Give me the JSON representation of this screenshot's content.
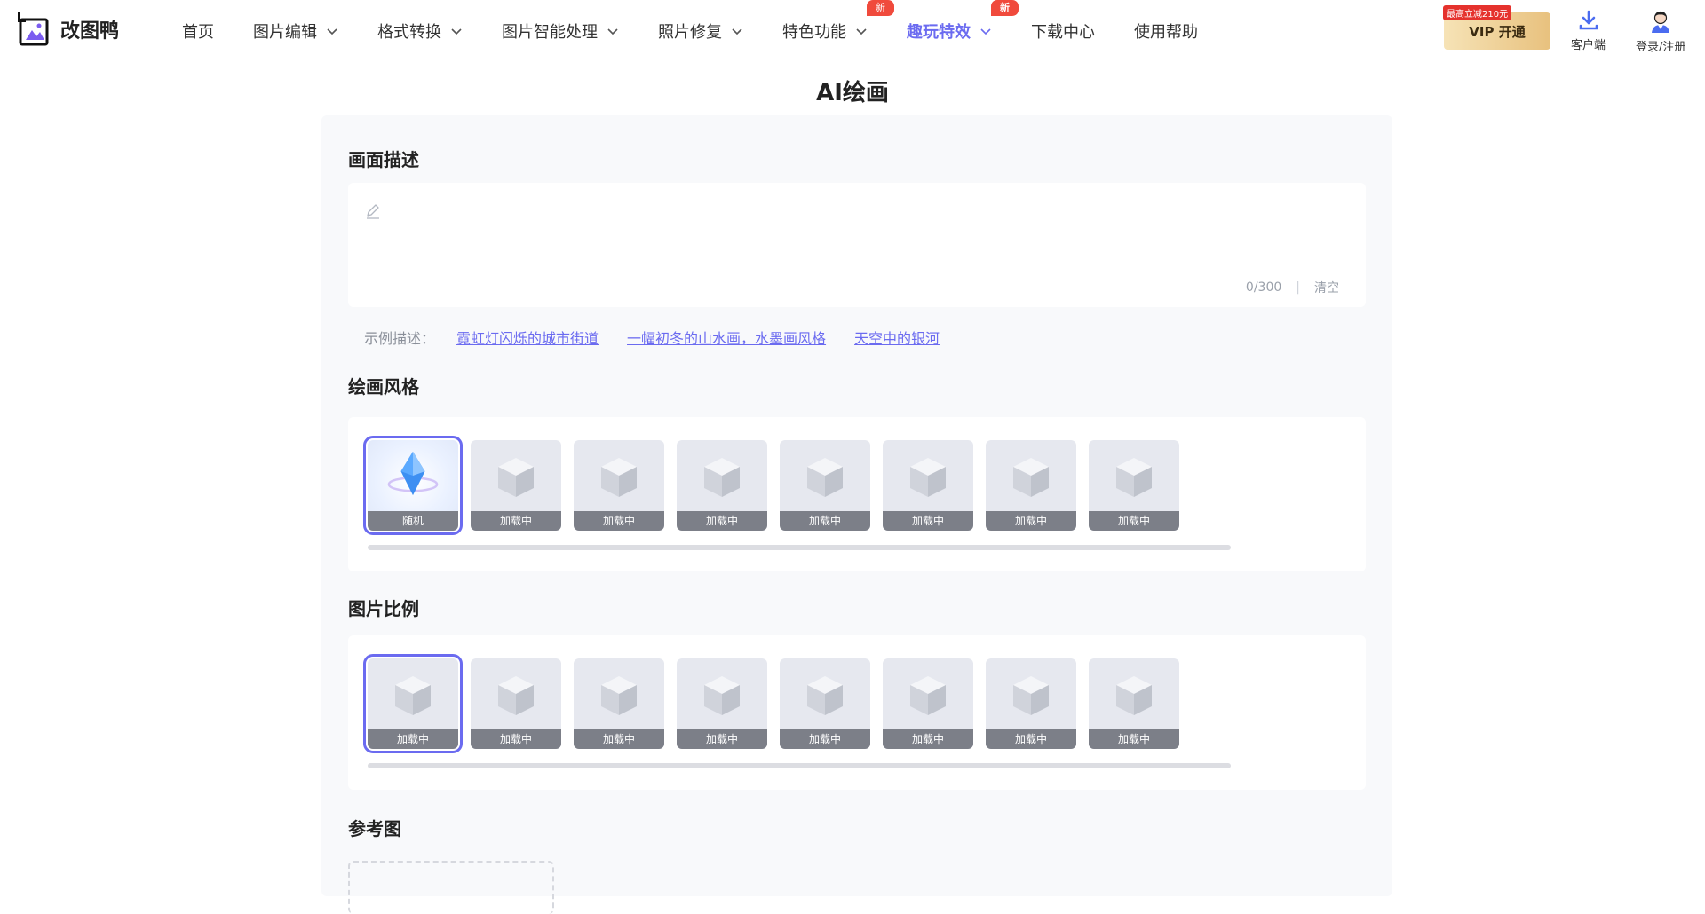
{
  "header": {
    "brand": "改图鸭",
    "nav": [
      {
        "label": "首页",
        "dropdown": false,
        "badge": "",
        "active": false
      },
      {
        "label": "图片编辑",
        "dropdown": true,
        "badge": "",
        "active": false
      },
      {
        "label": "格式转换",
        "dropdown": true,
        "badge": "",
        "active": false
      },
      {
        "label": "图片智能处理",
        "dropdown": true,
        "badge": "",
        "active": false
      },
      {
        "label": "照片修复",
        "dropdown": true,
        "badge": "",
        "active": false
      },
      {
        "label": "特色功能",
        "dropdown": true,
        "badge": "新",
        "active": false
      },
      {
        "label": "趣玩特效",
        "dropdown": true,
        "badge": "新",
        "active": true
      },
      {
        "label": "下载中心",
        "dropdown": false,
        "badge": "",
        "active": false
      },
      {
        "label": "使用帮助",
        "dropdown": false,
        "badge": "",
        "active": false
      }
    ],
    "vip": {
      "tag": "最高立减210元",
      "label": "VIP 开通"
    },
    "client_label": "客户端",
    "login_label": "登录/注册"
  },
  "page": {
    "title": "AI绘画",
    "prompt": {
      "section_title": "画面描述",
      "value": "",
      "counter": "0/300",
      "clear_label": "清空"
    },
    "examples": {
      "label": "示例描述：",
      "items": [
        "霓虹灯闪烁的城市街道",
        "一幅初冬的山水画，水墨画风格",
        "天空中的银河"
      ]
    },
    "style_section": {
      "title": "绘画风格",
      "items": [
        "随机",
        "加载中",
        "加载中",
        "加载中",
        "加载中",
        "加载中",
        "加载中",
        "加载中"
      ],
      "selected_index": 0
    },
    "size_section": {
      "title": "图片比例",
      "items": [
        "加载中",
        "加载中",
        "加载中",
        "加载中",
        "加载中",
        "加载中",
        "加载中",
        "加载中"
      ],
      "selected_index": 0
    },
    "reference_section": {
      "title": "参考图"
    }
  },
  "colors": {
    "accent": "#6b6bf0",
    "badge_red": "#f04a3c",
    "panel_bg": "#f8f9fb",
    "thumb_bg": "#e6e8ef",
    "caption_bg": "#7c7f88"
  }
}
